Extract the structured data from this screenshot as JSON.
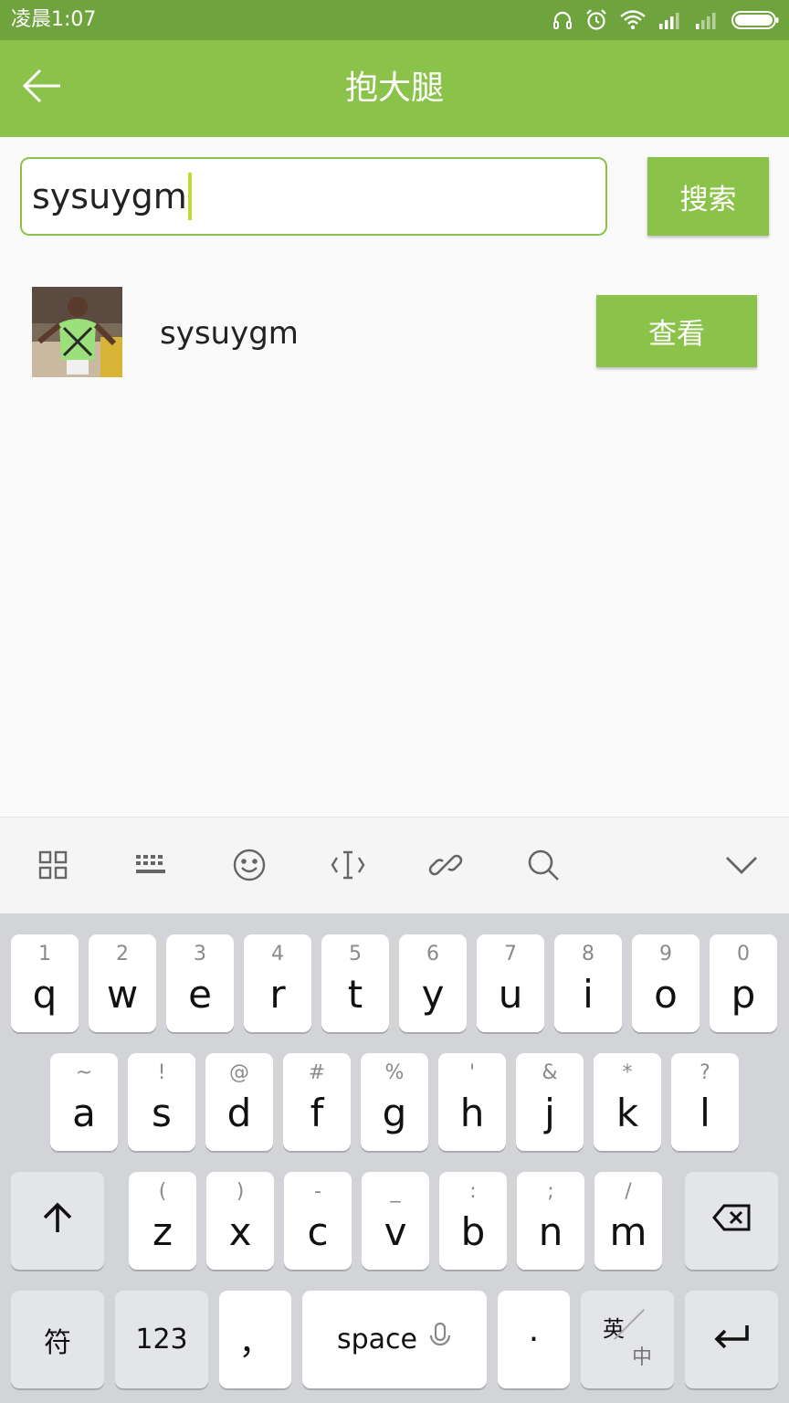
{
  "status_bar": {
    "time": "凌晨1:07"
  },
  "app_bar": {
    "title": "抱大腿"
  },
  "search": {
    "value": "sysuygm",
    "button_label": "搜索"
  },
  "results": [
    {
      "name": "sysuygm",
      "button_label": "查看"
    }
  ],
  "keyboard": {
    "row1": [
      {
        "hint": "1",
        "char": "q"
      },
      {
        "hint": "2",
        "char": "w"
      },
      {
        "hint": "3",
        "char": "e"
      },
      {
        "hint": "4",
        "char": "r"
      },
      {
        "hint": "5",
        "char": "t"
      },
      {
        "hint": "6",
        "char": "y"
      },
      {
        "hint": "7",
        "char": "u"
      },
      {
        "hint": "8",
        "char": "i"
      },
      {
        "hint": "9",
        "char": "o"
      },
      {
        "hint": "0",
        "char": "p"
      }
    ],
    "row2": [
      {
        "hint": "~",
        "char": "a"
      },
      {
        "hint": "!",
        "char": "s"
      },
      {
        "hint": "@",
        "char": "d"
      },
      {
        "hint": "#",
        "char": "f"
      },
      {
        "hint": "%",
        "char": "g"
      },
      {
        "hint": "'",
        "char": "h"
      },
      {
        "hint": "&",
        "char": "j"
      },
      {
        "hint": "*",
        "char": "k"
      },
      {
        "hint": "?",
        "char": "l"
      }
    ],
    "row3": [
      {
        "hint": "(",
        "char": "z"
      },
      {
        "hint": ")",
        "char": "x"
      },
      {
        "hint": "-",
        "char": "c"
      },
      {
        "hint": "_",
        "char": "v"
      },
      {
        "hint": ":",
        "char": "b"
      },
      {
        "hint": ";",
        "char": "n"
      },
      {
        "hint": "/",
        "char": "m"
      }
    ],
    "symbols_label": "符",
    "numbers_label": "123",
    "comma_label": "，",
    "space_label": "space",
    "period_label": "·",
    "lang_top": "英",
    "lang_bottom": "中"
  },
  "colors": {
    "primary": "#8bc34a",
    "status_bar": "#6fa33d",
    "cursor": "#c6d835"
  },
  "icons": [
    "back-arrow-icon",
    "headphone-icon",
    "alarm-icon",
    "wifi-icon",
    "signal-icon",
    "battery-icon",
    "grid-icon",
    "keyboard-icon",
    "emoji-icon",
    "text-cursor-icon",
    "link-icon",
    "search-icon",
    "chevron-down-icon",
    "shift-icon",
    "backspace-icon",
    "microphone-icon",
    "enter-icon"
  ]
}
